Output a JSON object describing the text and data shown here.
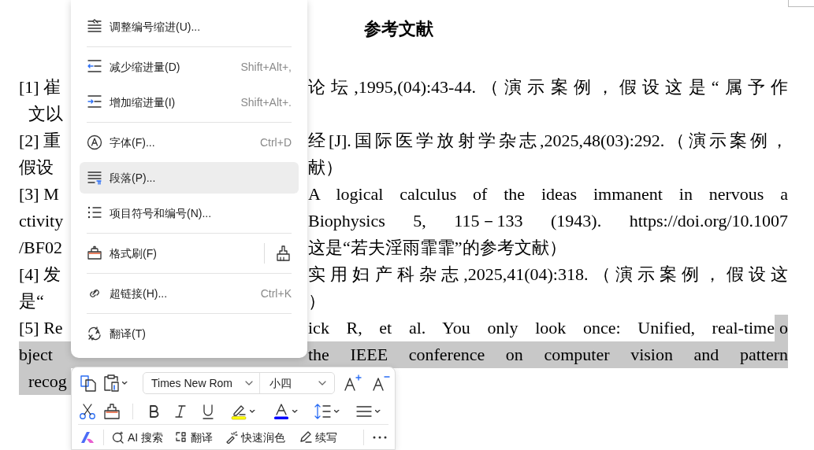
{
  "document": {
    "title": "参考文献",
    "lines": [
      {
        "kind": "justified",
        "left": "[1] 崔",
        "right": "论坛,1995,(04):43-44.（演示案例，假设这是“属予作",
        "highlighted": false
      },
      {
        "kind": "ragged",
        "left": "文以",
        "highlighted": false
      },
      {
        "kind": "justified",
        "left": "[2] 重",
        "right": "经[J].国际医学放射学杂志,2025,48(03):292.（演示案例，",
        "highlighted": false
      },
      {
        "kind": "ragged",
        "left": "假设",
        "right": "献）",
        "highlighted": false
      },
      {
        "kind": "justified",
        "left": "[3] M",
        "right": "A logical calculus of the ideas immanent in nervous a",
        "highlighted": false
      },
      {
        "kind": "justified",
        "left": "ctivity",
        "right": "Biophysics 5, 115－133 (1943). https://doi.org/10.1007",
        "highlighted": false
      },
      {
        "kind": "ragged",
        "left": "/BF02",
        "right": "这是“若夫淫雨霏霏”的参考文献）",
        "highlighted": false
      },
      {
        "kind": "justified",
        "left": "[4] 发",
        "right": "实用妇产科杂志,2025,41(04):318.（演示案例，假设这",
        "highlighted": false
      },
      {
        "kind": "ragged",
        "left": "是“",
        "right": "）",
        "highlighted": false
      },
      {
        "kind": "justified",
        "left": "[5] Re",
        "right": "ick R, et al. You only look once: Unified, real-time",
        "highlighted_tail": "o",
        "highlighted": false
      },
      {
        "kind": "justified",
        "left": "bject",
        "right": "the IEEE conference on computer vision and pattern",
        "highlighted": true
      },
      {
        "kind": "ragged",
        "left": "recog",
        "highlighted": true
      }
    ]
  },
  "context_menu": {
    "items": [
      {
        "kind": "plain",
        "label": "调整编号缩进(U)...",
        "selected": false,
        "separator_above": false
      },
      {
        "kind": "plain",
        "label": "减少缩进量(D)",
        "shortcut": "Shift+Alt+,",
        "selected": false,
        "separator_above": true
      },
      {
        "kind": "plain",
        "label": "增加缩进量(I)",
        "shortcut": "Shift+Alt+.",
        "selected": false,
        "separator_above": false
      },
      {
        "kind": "plain",
        "label": "字体(F)...",
        "shortcut": "Ctrl+D",
        "selected": false,
        "separator_above": true
      },
      {
        "kind": "plain",
        "label": "段落(P)...",
        "selected": true,
        "separator_above": false
      },
      {
        "kind": "plain",
        "label": "项目符号和编号(N)...",
        "selected": false,
        "separator_above": false
      },
      {
        "kind": "split",
        "label": "格式刷(F)",
        "selected": false,
        "separator_above": true
      },
      {
        "kind": "plain",
        "label": "超链接(H)...",
        "shortcut": "Ctrl+K",
        "selected": false,
        "separator_above": true
      },
      {
        "kind": "plain",
        "label": "翻译(T)",
        "selected": false,
        "separator_above": true
      }
    ]
  },
  "mini_toolbar": {
    "font_name": "Times New Rom",
    "font_size": "小四",
    "actions": [
      "AI 搜索",
      "翻译",
      "快速润色",
      "续写"
    ]
  }
}
